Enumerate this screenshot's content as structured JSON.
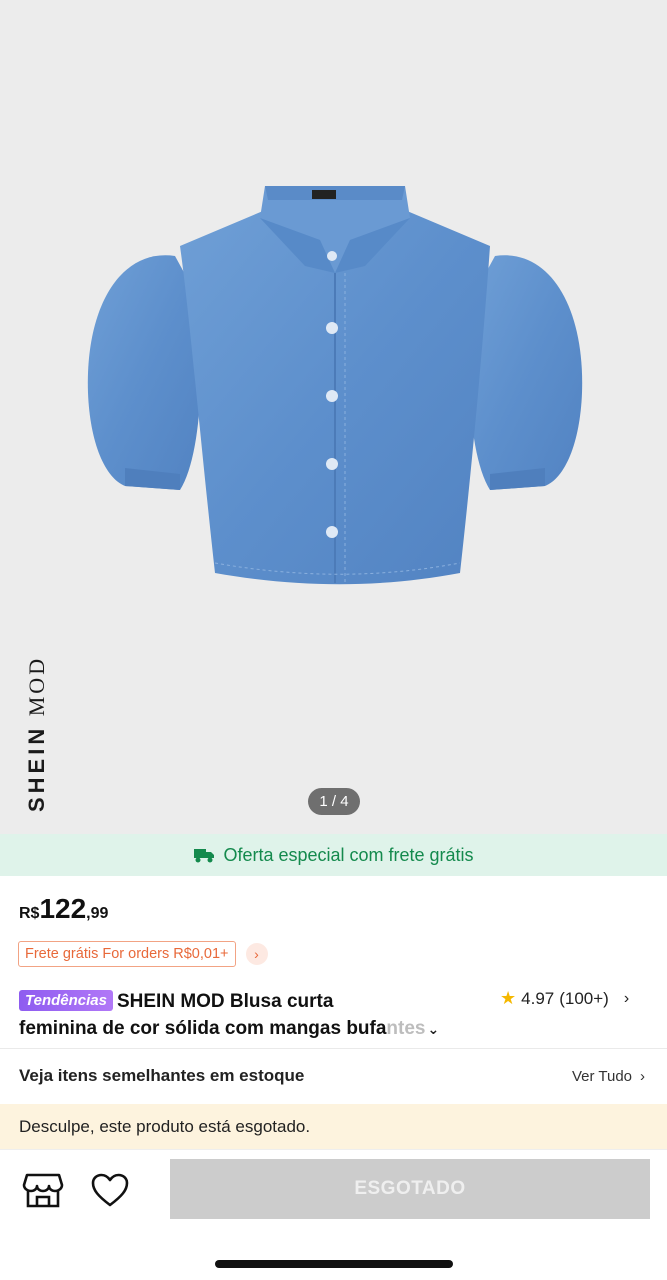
{
  "hero": {
    "brand_bold": "SHEIN",
    "brand_light": "MOD",
    "image_counter": "1 / 4"
  },
  "promo": {
    "text": "Oferta especial com frete grátis",
    "icon": "truck-icon",
    "color": "#148a4d",
    "background": "#dff3ea"
  },
  "price": {
    "currency": "R$",
    "integer": "122",
    "decimal": ",99"
  },
  "shipping": {
    "tag": "Frete grátis For orders R$0,01+",
    "icon": "chevron-right-icon"
  },
  "product": {
    "badge": "Tendências",
    "title_line1": "SHEIN MOD Blusa curta",
    "title_line2": "feminina de cor sólida com mangas bufa",
    "title_fade": "ntes",
    "expand_icon": "chevron-down-icon"
  },
  "rating": {
    "score": "4.97",
    "count": "(100+)"
  },
  "similar": {
    "label": "Veja itens semelhantes em estoque",
    "link": "Ver Tudo"
  },
  "notice": {
    "text": "Desculpe, este produto está esgotado."
  },
  "bottom_bar": {
    "store_icon": "store-icon",
    "wishlist_icon": "heart-icon",
    "button_label": "ESGOTADO"
  }
}
